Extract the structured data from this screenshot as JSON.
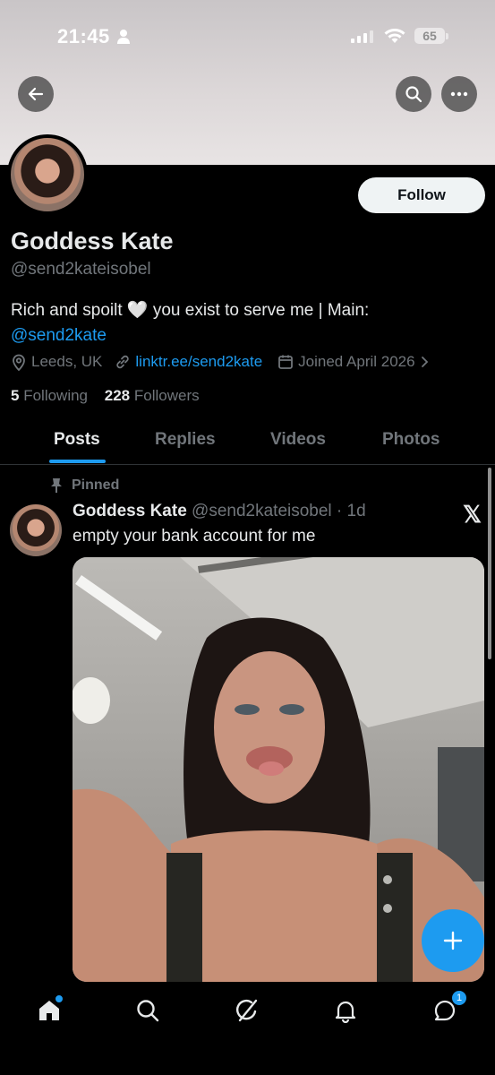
{
  "status_bar": {
    "time": "21:45",
    "battery": "65"
  },
  "header": {
    "follow_label": "Follow"
  },
  "profile": {
    "name": "Goddess Kate",
    "handle": "@send2kateisobel",
    "bio_text": "Rich and spoilt 🤍 you exist to serve me | Main:",
    "bio_link": "@send2kate",
    "location": "Leeds, UK",
    "website": "linktr.ee/send2kate",
    "joined": "Joined April 2026",
    "following_count": "5",
    "following_label": "Following",
    "followers_count": "228",
    "followers_label": "Followers"
  },
  "tabs": [
    {
      "label": "Posts",
      "active": true
    },
    {
      "label": "Replies",
      "active": false
    },
    {
      "label": "Videos",
      "active": false
    },
    {
      "label": "Photos",
      "active": false
    }
  ],
  "post": {
    "pinned_label": "Pinned",
    "author": "Goddess Kate",
    "handle_time": "@send2kateisobel · 1d",
    "text": "empty your bank account for me"
  },
  "nav": {
    "messages_badge": "1"
  },
  "colors": {
    "accent": "#1d9bf0",
    "background": "#000000",
    "muted": "#71767b"
  }
}
